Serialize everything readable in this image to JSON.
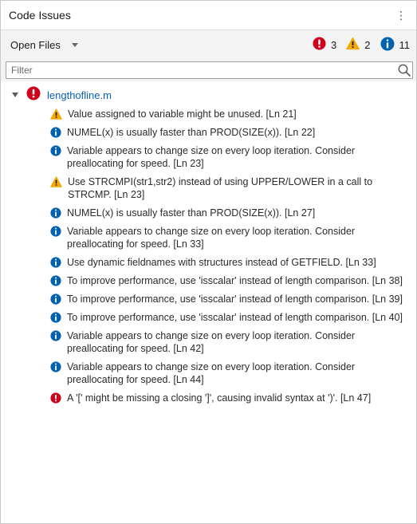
{
  "header": {
    "title": "Code Issues",
    "menu_glyph": "⋮"
  },
  "toolbar": {
    "scope_label": "Open Files",
    "counts": {
      "errors": "3",
      "warnings": "2",
      "info": "11"
    }
  },
  "filter": {
    "placeholder": "Filter",
    "value": ""
  },
  "file": {
    "name": "lengthofline.m"
  },
  "issues": [
    {
      "type": "warning",
      "text": "Value assigned to variable might be unused. [Ln 21]"
    },
    {
      "type": "info",
      "text": "NUMEL(x) is usually faster than PROD(SIZE(x)). [Ln 22]"
    },
    {
      "type": "info",
      "text": "Variable appears to change size on every loop iteration. Consider preallocating for speed. [Ln 23]"
    },
    {
      "type": "warning",
      "text": "Use STRCMPI(str1,str2) instead of using UPPER/LOWER in a call to STRCMP. [Ln 23]"
    },
    {
      "type": "info",
      "text": "NUMEL(x) is usually faster than PROD(SIZE(x)). [Ln 27]"
    },
    {
      "type": "info",
      "text": "Variable appears to change size on every loop iteration. Consider preallocating for speed. [Ln 33]"
    },
    {
      "type": "info",
      "text": "Use dynamic fieldnames with structures instead of GETFIELD. [Ln 33]"
    },
    {
      "type": "info",
      "text": "To improve performance, use 'isscalar' instead of length comparison. [Ln 38]"
    },
    {
      "type": "info",
      "text": "To improve performance, use 'isscalar' instead of length comparison. [Ln 39]"
    },
    {
      "type": "info",
      "text": "To improve performance, use 'isscalar' instead of length comparison. [Ln 40]"
    },
    {
      "type": "info",
      "text": "Variable appears to change size on every loop iteration. Consider preallocating for speed. [Ln 42]"
    },
    {
      "type": "info",
      "text": "Variable appears to change size on every loop iteration. Consider preallocating for speed. [Ln 44]"
    },
    {
      "type": "error",
      "text": "A '[' might be missing a closing ']', causing invalid syntax at ')'. [Ln 47]"
    }
  ],
  "colors": {
    "error": "#d0021b",
    "warning": "#f2a900",
    "info": "#0062b1",
    "link": "#0a5fb4"
  },
  "icons": {
    "error": "error-icon",
    "warning": "warning-icon",
    "info": "info-icon"
  }
}
